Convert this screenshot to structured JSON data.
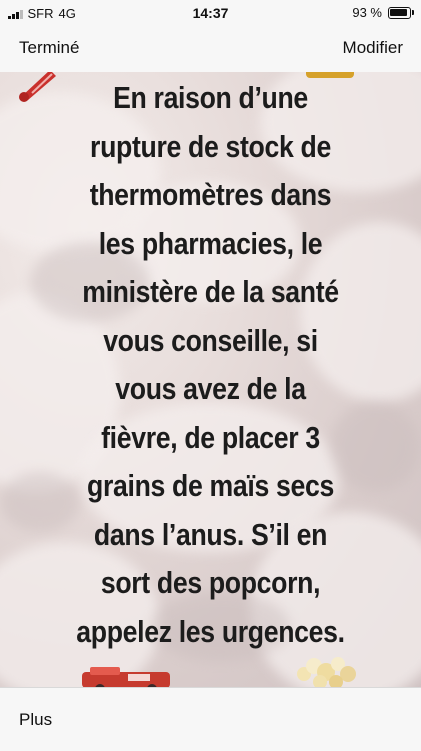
{
  "status_bar": {
    "carrier": "SFR",
    "network": "4G",
    "time": "14:37",
    "battery_text": "93 %",
    "battery_level": 0.93,
    "signal_bars": 3,
    "signal_bars_total": 4
  },
  "nav": {
    "done_label": "Terminé",
    "edit_label": "Modifier"
  },
  "image": {
    "message_lines": [
      "En raison d’une",
      "rupture de stock de",
      "thermomètres dans",
      "les pharmacies, le",
      "ministère de la santé",
      "vous conseille, si",
      "vous avez de la",
      "fièvre, de placer 3",
      "grains de maïs secs",
      "dans l’anus. S’il en",
      "sort des popcorn,",
      "appelez les urgences."
    ],
    "text_color": "#1c1c1c"
  },
  "bottom": {
    "more_label": "Plus"
  }
}
